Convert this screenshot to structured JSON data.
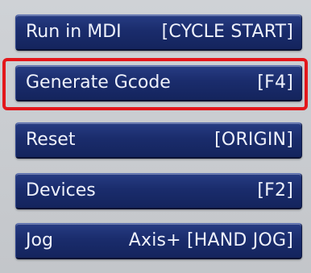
{
  "panel": {
    "buttons": [
      {
        "label": "Run in MDI",
        "key": "[CYCLE START]",
        "name": "run-in-mdi-button"
      },
      {
        "label": "Generate Gcode",
        "key": "[F4]",
        "name": "generate-gcode-button"
      },
      {
        "label": "Reset",
        "key": "[ORIGIN]",
        "name": "reset-button"
      },
      {
        "label": "Devices",
        "key": "[F2]",
        "name": "devices-button"
      },
      {
        "label": "Jog",
        "key": "Axis+ [HAND JOG]",
        "name": "jog-button"
      }
    ]
  },
  "colors": {
    "button_bg": "#1a2c6c",
    "button_text": "#eef1fb",
    "highlight": "#e3171b",
    "background": "#c9ccd0"
  },
  "highlighted_button": "Generate Gcode"
}
